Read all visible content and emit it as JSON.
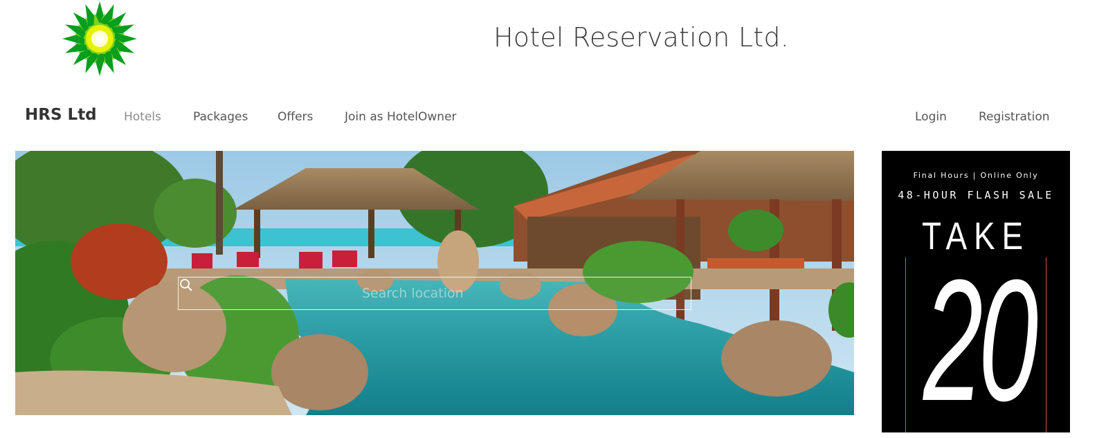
{
  "header": {
    "logo_name": "sunflower-logo",
    "title": "Hotel Reservation Ltd."
  },
  "navbar": {
    "brand": "HRS Ltd",
    "links": [
      "Hotels",
      "Packages",
      "Offers",
      "Join as HotelOwner"
    ],
    "right_links": [
      "Login",
      "Registration"
    ]
  },
  "hero": {
    "search_placeholder": "Search location",
    "search_icon": "search-icon"
  },
  "ad": {
    "line1": "Final Hours | Online Only",
    "line2": "48-HOUR FLASH SALE",
    "line3": "TAKE",
    "line4": "20",
    "accent": "#d9534f"
  },
  "colors": {
    "logo_green": "#0a9e1e",
    "logo_yellow": "#e8f000",
    "text": "#333333",
    "nav_muted": "#8b8b8b"
  }
}
